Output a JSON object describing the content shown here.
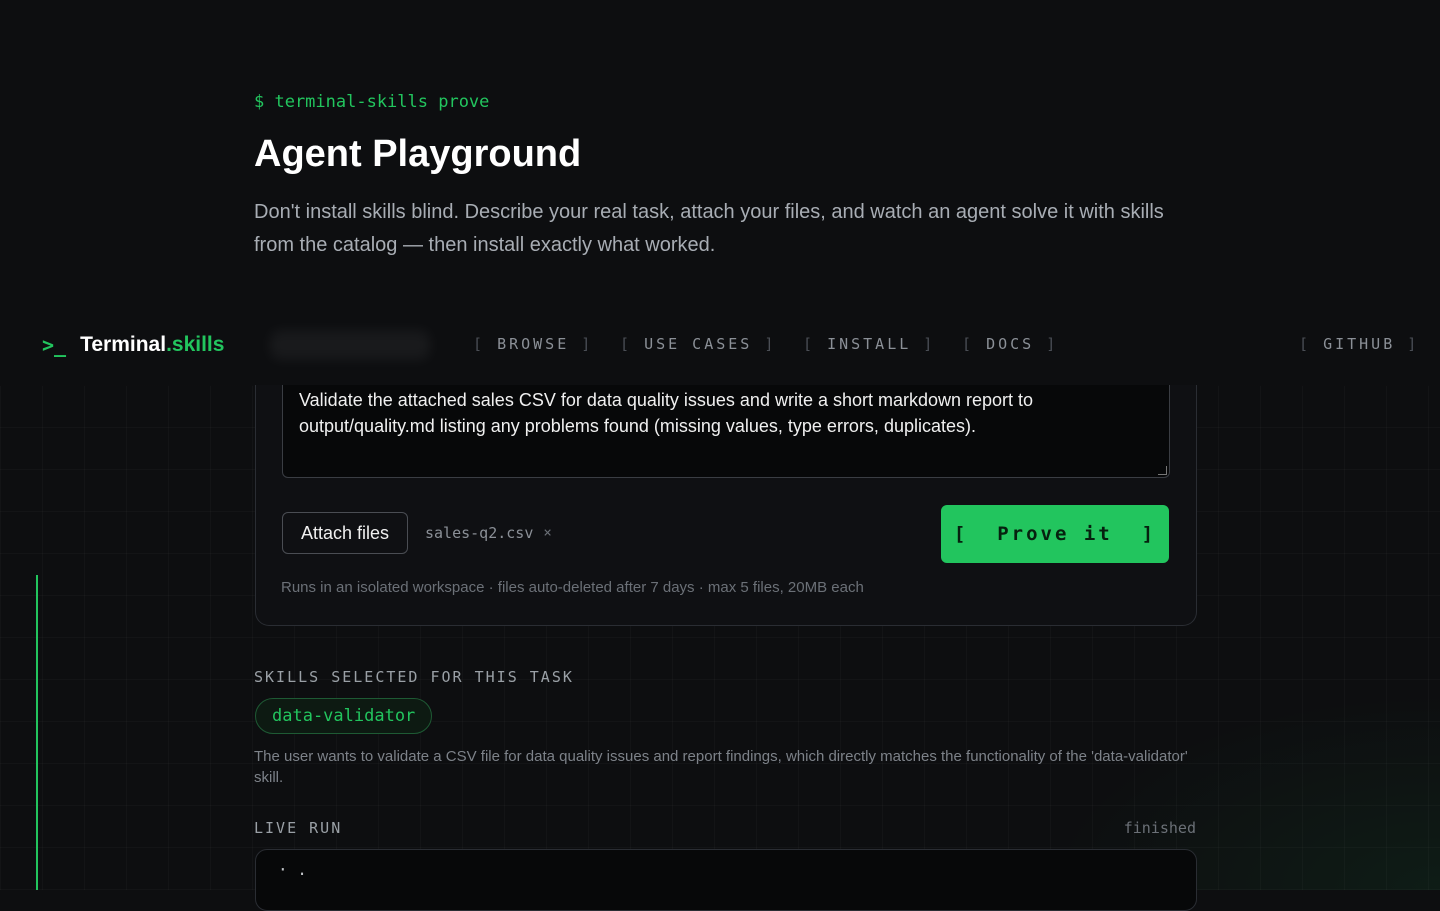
{
  "hero": {
    "prompt": "$ terminal-skills prove",
    "title": "Agent Playground",
    "description": "Don't install skills blind. Describe your real task, attach your files, and watch an agent solve it with skills from the catalog — then install exactly what worked."
  },
  "nav": {
    "logo_mark": ">_",
    "logo_main": "Terminal",
    "logo_accent": ".skills",
    "links": [
      "BROWSE",
      "USE CASES",
      "INSTALL",
      "DOCS"
    ],
    "github": "GITHUB"
  },
  "task": {
    "text": "Validate the attached sales CSV for data quality issues and write a short markdown report to output/quality.md listing any problems found (missing values, type errors, duplicates).",
    "attach_label": "Attach files",
    "file_name": "sales-q2.csv",
    "file_remove": "×",
    "prove_label": "[  Prove it  ]",
    "footnote": "Runs in an isolated workspace · files auto-deleted after 7 days · max 5 files, 20MB each"
  },
  "skills": {
    "heading": "SKILLS SELECTED FOR THIS TASK",
    "selected": "data-validator",
    "reason": "The user wants to validate a CSV file for data quality issues and report findings, which directly matches the functionality of the 'data-validator' skill."
  },
  "live_run": {
    "heading": "LIVE RUN",
    "status": "finished",
    "output": "· ."
  },
  "colors": {
    "accent": "#22c55e",
    "background": "#0d0e10"
  }
}
